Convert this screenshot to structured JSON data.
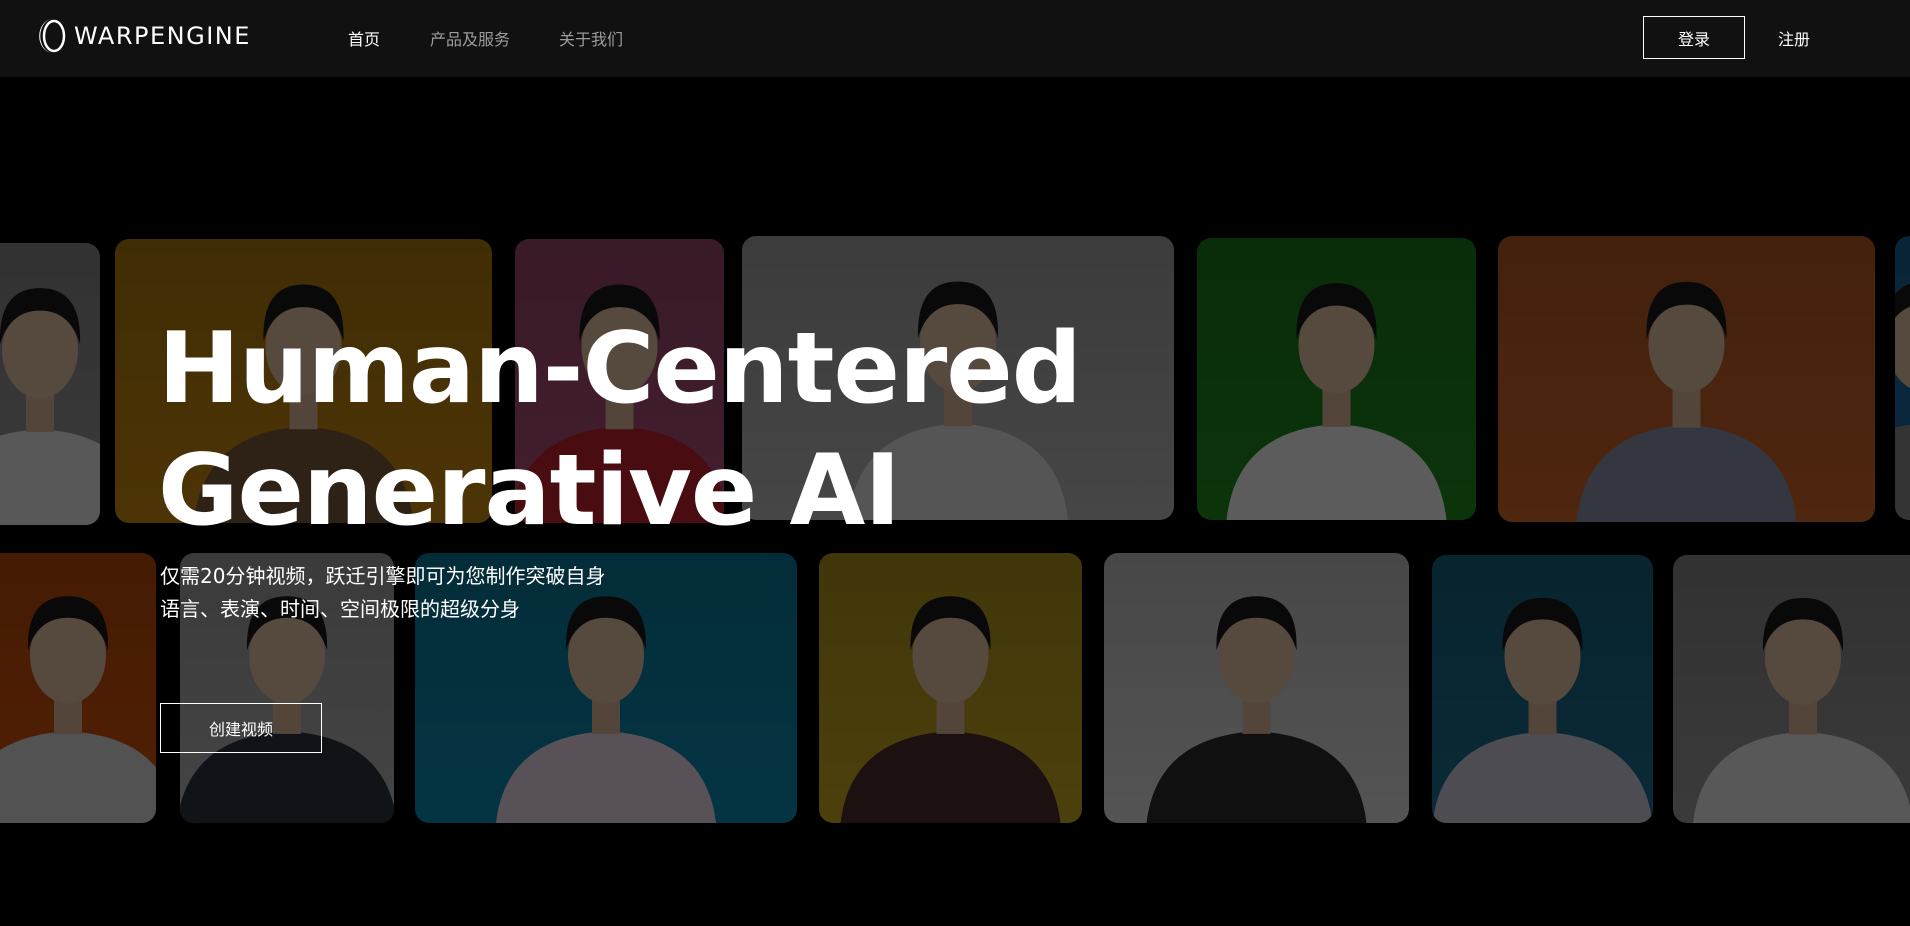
{
  "header": {
    "brand": "WARPENGINE",
    "nav": [
      {
        "label": "首页",
        "active": true
      },
      {
        "label": "产品及服务",
        "active": false
      },
      {
        "label": "关于我们",
        "active": false
      }
    ],
    "login_label": "登录",
    "register_label": "注册"
  },
  "hero": {
    "title_line1": "Human-Centered",
    "title_line2": "Generative AI",
    "subtitle_line1": "仅需20分钟视频，跃迁引擎即可为您制作突破自身",
    "subtitle_line2": "语言、表演、时间、空间极限的超级分身",
    "cta_label": "创建视频"
  },
  "colors": {
    "header_bg": "#111111",
    "page_bg": "#000000",
    "nav_inactive": "#9c9c9c",
    "text": "#ffffff"
  },
  "avatar_cards": [
    {
      "bg": "#9a9a9a",
      "shirt": "#e8e8e8"
    },
    {
      "bg": "#c98a10",
      "shirt": "#7a5a3a"
    },
    {
      "bg": "#b0507a",
      "shirt": "#c0242e"
    },
    {
      "bg": "#b8b8b8",
      "shirt": "#e0e0e0"
    },
    {
      "bg": "#1e8a1e",
      "shirt": "#f2f2f2"
    },
    {
      "bg": "#d0662a",
      "shirt": "#8a90a8"
    },
    {
      "bg": "#1e6fa8",
      "shirt": "#8a8a8a"
    },
    {
      "bg": "#d6540e",
      "shirt": "#d8d8d8"
    },
    {
      "bg": "#b5b5b5",
      "shirt": "#2c3240"
    },
    {
      "bg": "#0c8ab0",
      "shirt": "#e8d8e8"
    },
    {
      "bg": "#c8a820",
      "shirt": "#4a2c2c"
    },
    {
      "bg": "#dcdcdc",
      "shirt": "#2a2a2a"
    },
    {
      "bg": "#1a7090",
      "shirt": "#c8c8d8"
    }
  ]
}
